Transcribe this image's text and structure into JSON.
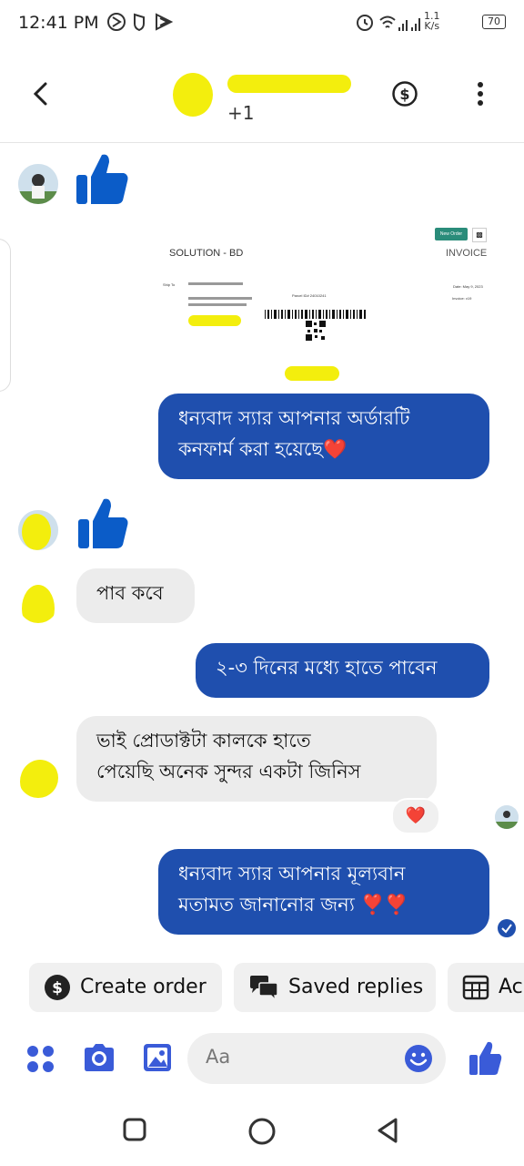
{
  "status_bar": {
    "time": "12:41 PM",
    "net_speed_value": "1.1",
    "net_speed_unit": "K/s",
    "battery": "70"
  },
  "header": {
    "participants_extra": "+1"
  },
  "invoice": {
    "company": "SOLUTION - BD",
    "badge": "New Order",
    "title": "INVOICE",
    "ship_to_label": "Ship To",
    "parcel_label": "Parcel ID# 24010241",
    "date_label": "Date: May 9, 2023",
    "invoice_label": "Invoice: v19"
  },
  "messages": [
    {
      "id": "m1",
      "direction": "out",
      "text_line1": "ধন্যবাদ স্যার  আপনার অর্ডারটি",
      "text_line2": "কনফার্ম করা হয়েছে❤️"
    },
    {
      "id": "m2",
      "direction": "in",
      "text_line1": "পাব কবে"
    },
    {
      "id": "m3",
      "direction": "out",
      "text_line1": "২-৩ দিনের মধ্যে হাতে পাবেন"
    },
    {
      "id": "m4",
      "direction": "in",
      "text_line1": "ভাই প্রোডাক্টটা কালকে হাতে",
      "text_line2": "পেয়েছি অনেক সুন্দর একটা জিনিস",
      "reaction": "❤️"
    },
    {
      "id": "m5",
      "direction": "out",
      "text_line1": "ধন্যবাদ স্যার আপনার মূল্যবান",
      "text_line2": "মতামত জানানোর জন্য ❣️❣️"
    }
  ],
  "quick_replies": [
    {
      "label": "Create order",
      "icon": "dollar-circle-icon"
    },
    {
      "label": "Saved replies",
      "icon": "speech-bubbles-icon"
    },
    {
      "label": "Ac",
      "icon": "calendar-table-icon"
    }
  ],
  "composer": {
    "placeholder": "Aa"
  },
  "colors": {
    "accent": "#1f4fae",
    "brand": "#3a5bd8",
    "like": "#0b5cc8",
    "bubble_in": "#ececec"
  }
}
